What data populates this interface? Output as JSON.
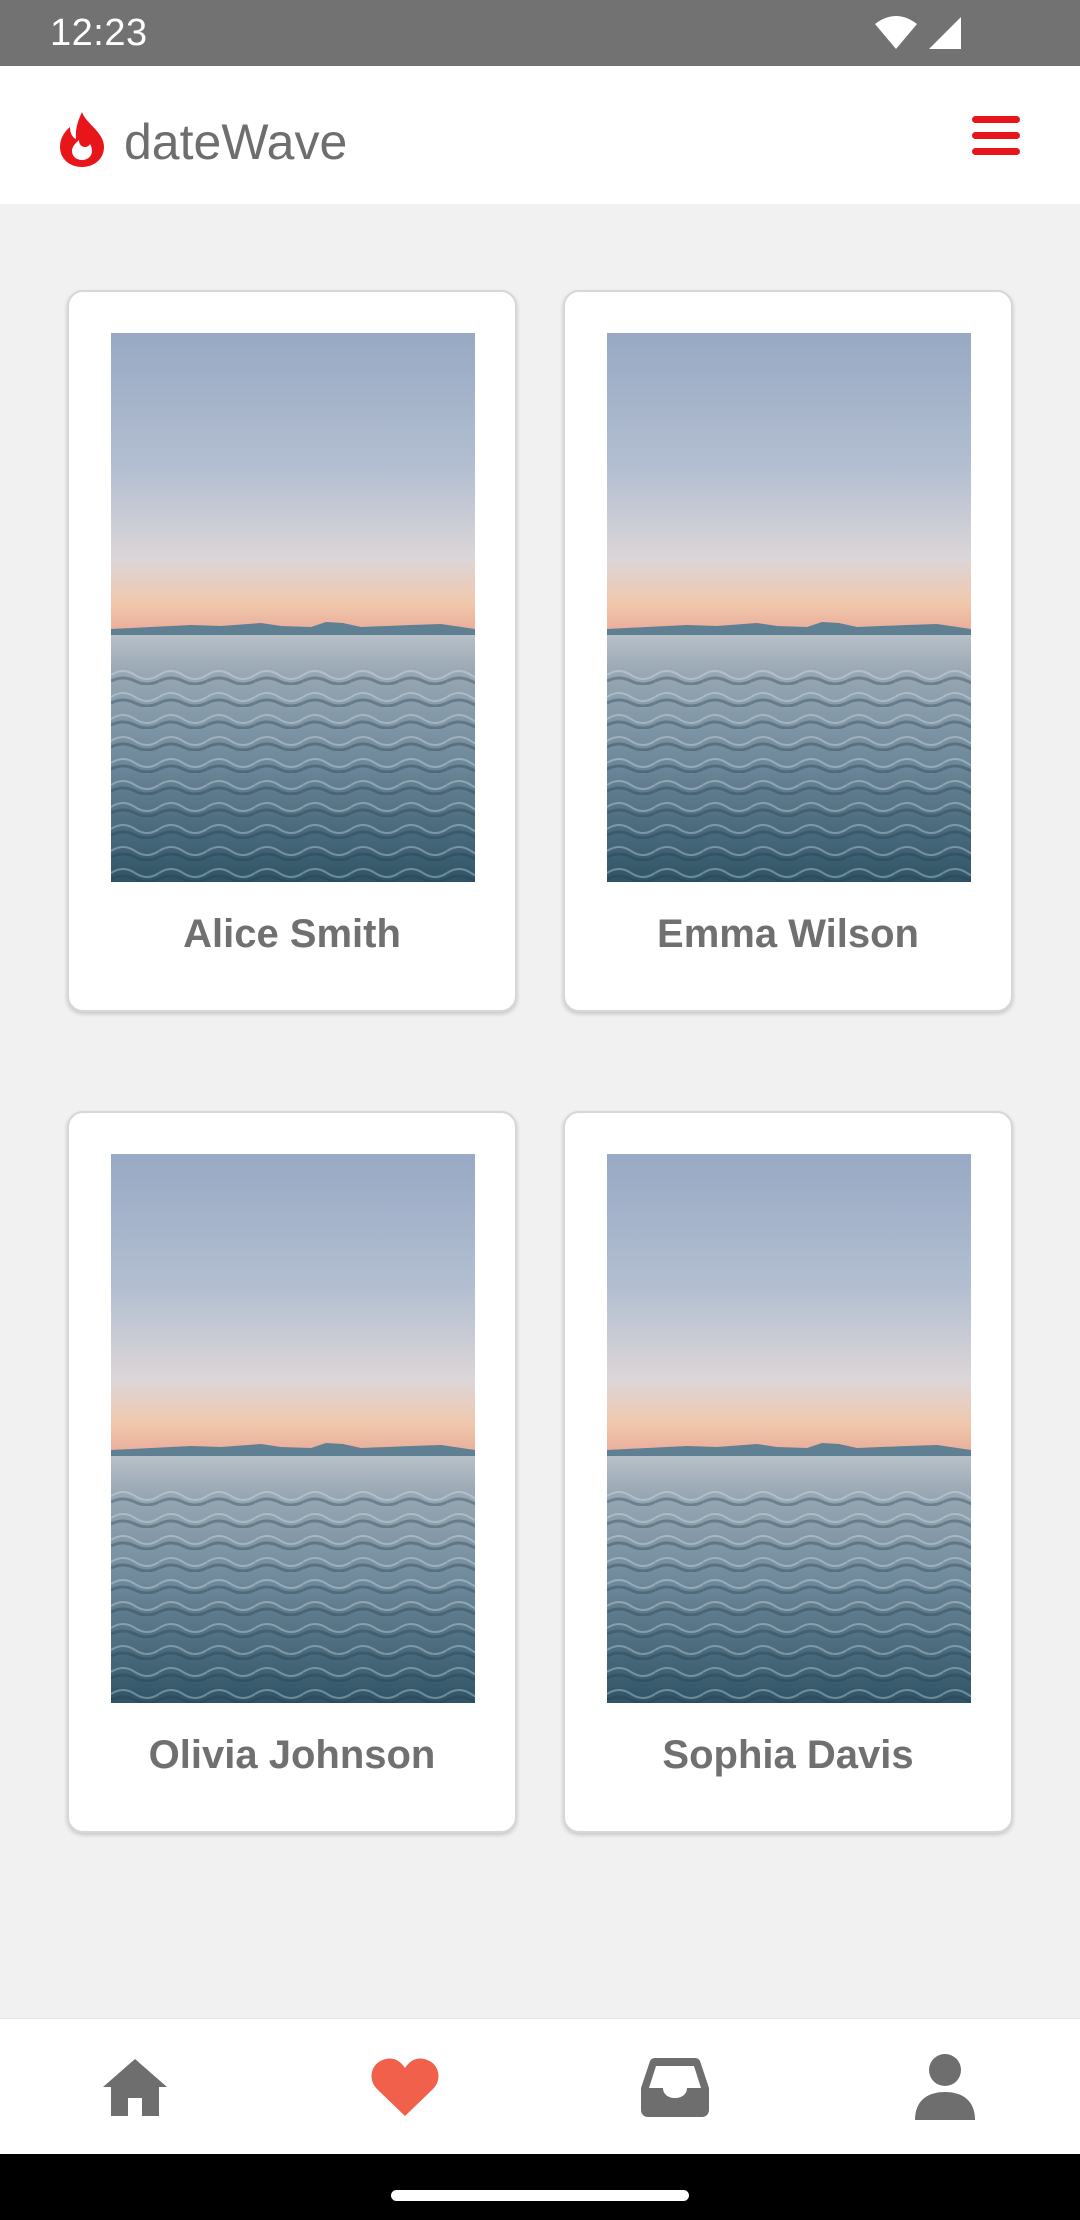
{
  "status_bar": {
    "time": "12:23",
    "icons": [
      "wifi-icon",
      "signal-icon"
    ]
  },
  "header": {
    "logo_icon": "flame-icon",
    "title": "dateWave",
    "menu_icon": "hamburger-menu-icon",
    "accent_color": "#e8151b"
  },
  "profiles": [
    {
      "name": "Alice Smith"
    },
    {
      "name": "Emma Wilson"
    },
    {
      "name": "Olivia Johnson"
    },
    {
      "name": "Sophia Davis"
    }
  ],
  "bottom_nav": {
    "items": [
      {
        "icon": "home-icon",
        "active": false
      },
      {
        "icon": "heart-icon",
        "active": true
      },
      {
        "icon": "inbox-icon",
        "active": false
      },
      {
        "icon": "profile-icon",
        "active": false
      }
    ],
    "active_color": "#f0604a",
    "inactive_color": "#6e6e6e"
  }
}
